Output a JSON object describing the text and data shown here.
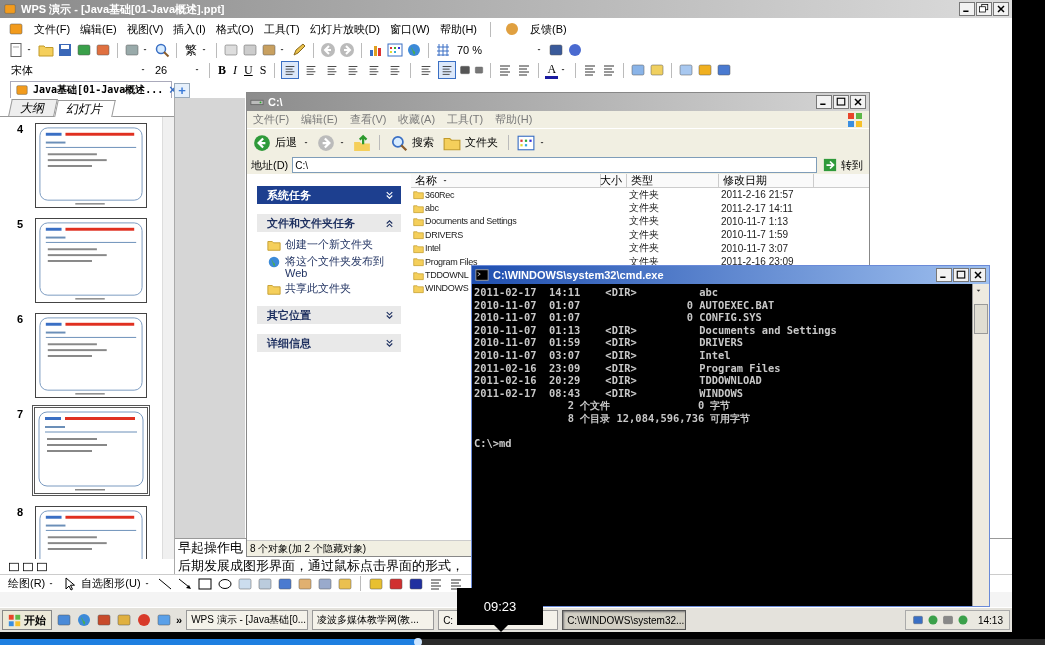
{
  "wps": {
    "title": "WPS 演示 - [Java基础[01-Java概述].ppt]",
    "menu": [
      "文件(F)",
      "编辑(E)",
      "视图(V)",
      "插入(I)",
      "格式(O)",
      "工具(T)",
      "幻灯片放映(D)",
      "窗口(W)",
      "帮助(H)"
    ],
    "feedback": "反馈(B)",
    "toolbar": {
      "traditional": "繁",
      "zoom": "70 %"
    },
    "format_bar": {
      "font": "宋体",
      "size": "26",
      "bold": "B",
      "italic": "I",
      "underline": "U",
      "shadow": "S",
      "font_color": "A"
    },
    "alignment_buttons": [
      {
        "selected": true
      },
      {
        "selected": false
      },
      {
        "selected": false
      },
      {
        "selected": false
      },
      {
        "selected": false
      },
      {
        "selected": false
      }
    ],
    "list_buttons": [
      {
        "selected": false
      },
      {
        "selected": true
      }
    ],
    "doc_tab": {
      "label": "Java基础[01-Java概述...",
      "close": "×",
      "add": "+"
    },
    "panel_tabs": [
      {
        "label": "大纲",
        "selected": false
      },
      {
        "label": "幻灯片",
        "selected": true
      }
    ],
    "slides": [
      {
        "number": "4",
        "selected": false
      },
      {
        "number": "5",
        "selected": false
      },
      {
        "number": "6",
        "selected": false
      },
      {
        "number": "7",
        "selected": true
      },
      {
        "number": "8",
        "selected": false
      }
    ],
    "notes": [
      "早起操作电",
      "后期发展成图形界面，通过鼠标点击界面的形式，"
    ],
    "drawing_bar": {
      "draw": "绘图(R)",
      "autoshapes": "自选图形(U)"
    }
  },
  "explorer": {
    "title": "C:\\",
    "menu": [
      "文件(F)",
      "编辑(E)",
      "查看(V)",
      "收藏(A)",
      "工具(T)",
      "帮助(H)"
    ],
    "back": "后退",
    "search": "搜索",
    "folders": "文件夹",
    "address_label": "地址(D)",
    "address": "C:\\",
    "go": "转到",
    "task_groups": [
      {
        "title": "系统任务",
        "kind": "special",
        "expanded": false
      },
      {
        "title": "文件和文件夹任务",
        "kind": "normal",
        "expanded": true,
        "links": [
          {
            "label": "创建一个新文件夹",
            "kind": "new-folder"
          },
          {
            "label": "将这个文件夹发布到 Web",
            "kind": "publish"
          },
          {
            "label": "共享此文件夹",
            "kind": "share"
          }
        ]
      },
      {
        "title": "其它位置",
        "kind": "normal",
        "expanded": false
      },
      {
        "title": "详细信息",
        "kind": "normal",
        "expanded": false
      }
    ],
    "columns": [
      {
        "label": "名称",
        "sorted": true
      },
      {
        "label": "大小",
        "sorted": false
      },
      {
        "label": "类型",
        "sorted": false
      },
      {
        "label": "修改日期",
        "sorted": false
      }
    ],
    "rows": [
      {
        "name": "360Rec",
        "type": "文件夹",
        "modified": "2011-2-16 21:57"
      },
      {
        "name": "abc",
        "type": "文件夹",
        "modified": "2011-2-17 14:11"
      },
      {
        "name": "Documents and Settings",
        "type": "文件夹",
        "modified": "2010-11-7 1:13"
      },
      {
        "name": "DRIVERS",
        "type": "文件夹",
        "modified": "2010-11-7 1:59"
      },
      {
        "name": "Intel",
        "type": "文件夹",
        "modified": "2010-11-7 3:07"
      },
      {
        "name": "Program Files",
        "type": "文件夹",
        "modified": "2011-2-16 23:09"
      },
      {
        "name": "TDDOWNL"
      },
      {
        "name": "WINDOWS"
      }
    ],
    "status": "8 个对象(加 2 个隐藏对象)"
  },
  "cmd": {
    "title": "C:\\WINDOWS\\system32\\cmd.exe",
    "lines": [
      "2011-02-17  14:11    <DIR>          abc",
      "2010-11-07  01:07                 0 AUTOEXEC.BAT",
      "2010-11-07  01:07                 0 CONFIG.SYS",
      "2010-11-07  01:13    <DIR>          Documents and Settings",
      "2010-11-07  01:59    <DIR>          DRIVERS",
      "2010-11-07  03:07    <DIR>          Intel",
      "2011-02-16  23:09    <DIR>          Program Files",
      "2011-02-16  20:29    <DIR>          TDDOWNLOAD",
      "2011-02-17  08:43    <DIR>          WINDOWS",
      "               2 个文件              0 字节",
      "               8 个目录 12,084,596,736 可用字节"
    ],
    "prompt": "C:\\>md"
  },
  "taskbar": {
    "start": "开始",
    "more": "»",
    "tasks": [
      {
        "label": "WPS 演示 - [Java基础[0...",
        "selected": false
      },
      {
        "label": "凌波多媒体教学网(教...",
        "selected": false
      },
      {
        "label": "C:",
        "selected": false
      },
      {
        "label": "C:\\WINDOWS\\system32...",
        "selected": true
      }
    ],
    "clock": "14:13"
  },
  "player": {
    "tooltip": "09:23",
    "level": 0.4
  }
}
